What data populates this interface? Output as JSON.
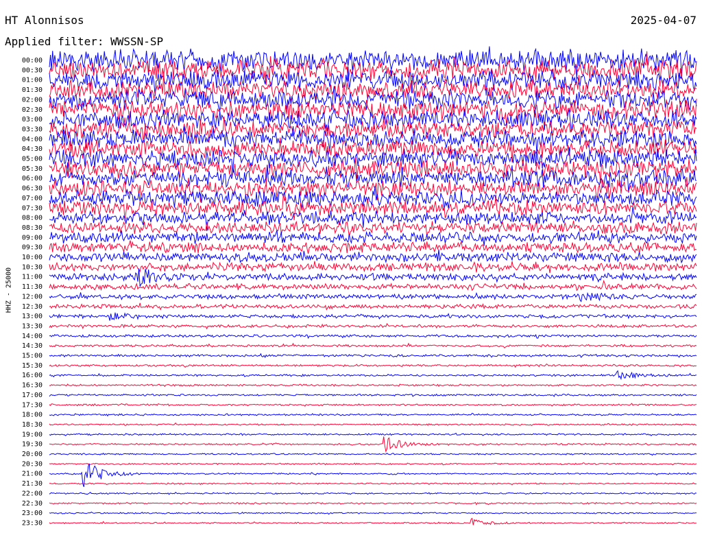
{
  "header": {
    "station": "HT Alonnisos",
    "date": "2025-04-07",
    "filter": "Applied filter: WWSSN-SP"
  },
  "axis": {
    "channel_label": "HHZ - 25000"
  },
  "colors": {
    "trace_a": "#0000ff",
    "trace_b": "#ff0033",
    "background": "#ffffff",
    "text": "#000000"
  },
  "chart_data": {
    "type": "line",
    "title": "HT Alonnisos",
    "subtitle": "Applied filter: WWSSN-SP",
    "ylabel": "HHZ - 25000",
    "row_labels": [
      "00:00",
      "00:30",
      "01:00",
      "01:30",
      "02:00",
      "02:30",
      "03:00",
      "03:30",
      "04:00",
      "04:30",
      "05:00",
      "05:30",
      "06:00",
      "06:30",
      "07:00",
      "07:30",
      "08:00",
      "08:30",
      "09:00",
      "09:30",
      "10:00",
      "10:30",
      "11:00",
      "11:30",
      "12:00",
      "12:30",
      "13:00",
      "13:30",
      "14:00",
      "14:30",
      "15:00",
      "15:30",
      "16:00",
      "16:30",
      "17:00",
      "17:30",
      "18:00",
      "18:30",
      "19:00",
      "19:30",
      "20:00",
      "20:30",
      "21:00",
      "21:30",
      "22:00",
      "22:30",
      "23:00",
      "23:30"
    ],
    "row_colors": "alternating blue / red",
    "noise_amplitude": [
      18,
      18,
      17,
      17,
      16,
      16,
      16,
      15,
      15,
      15,
      15,
      15,
      14,
      14,
      13,
      13,
      11,
      10,
      9,
      9,
      8,
      7,
      6,
      5,
      4,
      3.5,
      3,
      2.5,
      2.2,
      2,
      2,
      1.8,
      1.7,
      1.6,
      1.5,
      1.5,
      1.5,
      1.4,
      1.4,
      1.4,
      1.3,
      1.3,
      1.3,
      1.3,
      1.3,
      1.3,
      1.2,
      1.2
    ],
    "events": [
      {
        "row": "21:00",
        "minute": 1.5,
        "amplitude": 26
      },
      {
        "row": "19:30",
        "minute": 15.5,
        "amplitude": 13
      },
      {
        "row": "23:30",
        "minute": 19.5,
        "amplitude": 7
      },
      {
        "row": "16:00",
        "minute": 26.3,
        "amplitude": 8
      },
      {
        "row": "12:00",
        "minute": 24.5,
        "amplitude": 8
      },
      {
        "row": "11:00",
        "minute": 4,
        "amplitude": 14
      },
      {
        "row": "13:00",
        "minute": 2.7,
        "amplitude": 7
      }
    ],
    "grid": false,
    "legend": "none"
  }
}
